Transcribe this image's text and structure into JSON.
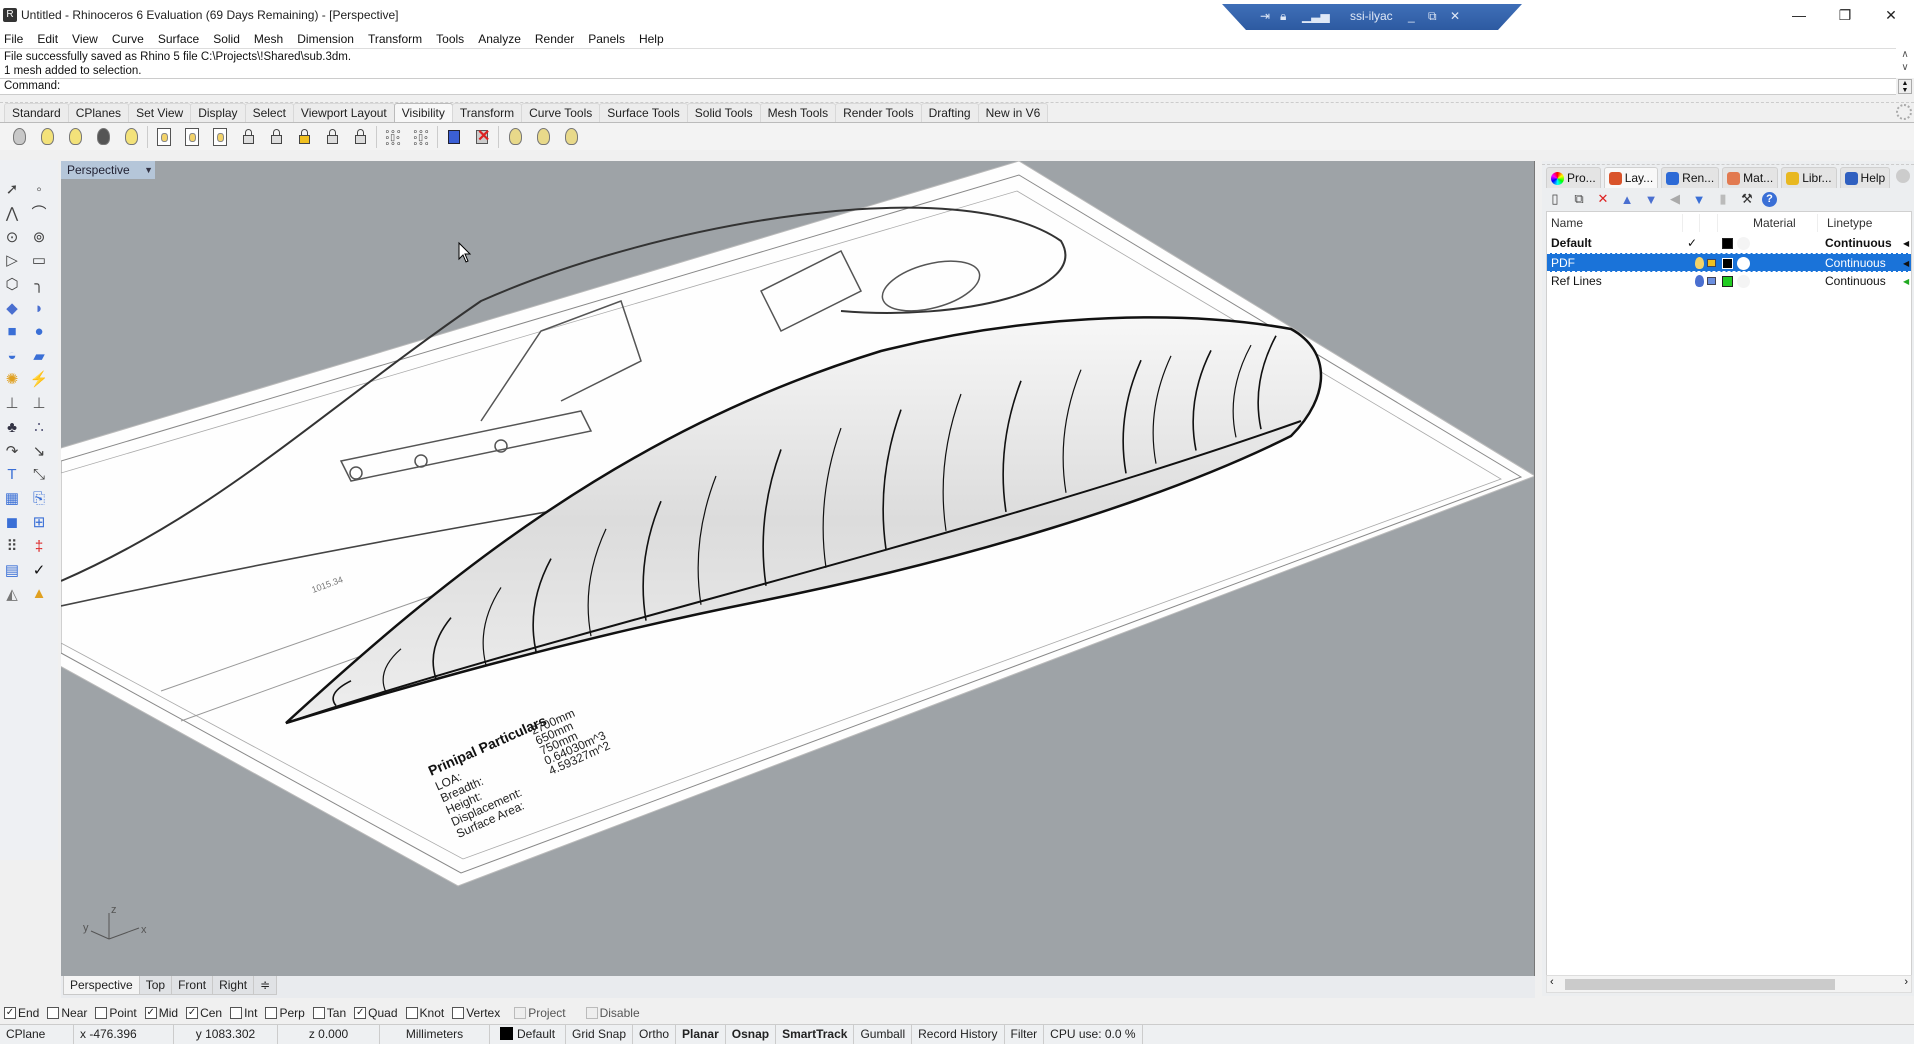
{
  "window": {
    "title": "Untitled - Rhinoceros 6 Evaluation (69 Days Remaining) - [Perspective]",
    "remote_session": "ssi-ilyac",
    "controls": {
      "minimize": "—",
      "restore": "❐",
      "close": "✕"
    }
  },
  "menu": [
    "File",
    "Edit",
    "View",
    "Curve",
    "Surface",
    "Solid",
    "Mesh",
    "Dimension",
    "Transform",
    "Tools",
    "Analyze",
    "Render",
    "Panels",
    "Help"
  ],
  "command_history": [
    "File successfully saved as Rhino 5 file C:\\Projects\\!Shared\\sub.3dm.",
    "1 mesh added to selection."
  ],
  "command": {
    "label": "Command:",
    "value": ""
  },
  "toolbar_tabs": {
    "items": [
      "Standard",
      "CPlanes",
      "Set View",
      "Display",
      "Select",
      "Viewport Layout",
      "Visibility",
      "Transform",
      "Curve Tools",
      "Surface Tools",
      "Solid Tools",
      "Mesh Tools",
      "Render Tools",
      "Drafting",
      "New in V6"
    ],
    "active": "Visibility"
  },
  "visibility_icons": [
    "hide-objects-icon",
    "show-objects-icon",
    "show-selected-icon",
    "hide-swap-icon",
    "swap-hidden-icon",
    "hide-in-detail-icon",
    "show-in-detail-icon",
    "show-selected-in-detail-icon",
    "lock-icon",
    "unlock-icon",
    "unlock-selected-icon",
    "lock-swap-icon",
    "swap-locked-icon",
    "hide-points-icon",
    "show-points-icon",
    "hide-in-viewport-icon",
    "show-in-viewport-icon",
    "hide-layers-icon",
    "show-layers-icon",
    "show-all-layers-icon"
  ],
  "viewport": {
    "name": "Perspective",
    "axes": {
      "x": "x",
      "y": "y",
      "z": "z"
    },
    "drawing": {
      "dimension": "1015.34",
      "particulars_title": "Prinipal Particulars",
      "particulars": [
        {
          "label": "LOA:",
          "value": "2700mm"
        },
        {
          "label": "Breadth:",
          "value": "650mm"
        },
        {
          "label": "Height:",
          "value": "750mm"
        },
        {
          "label": "Displacement:",
          "value": "0.64030m^3"
        },
        {
          "label": "Surface Area:",
          "value": "4.59327m^2"
        }
      ]
    }
  },
  "viewport_tabs": {
    "items": [
      "Perspective",
      "Top",
      "Front",
      "Right"
    ],
    "active": "Perspective",
    "more": "≑"
  },
  "osnaps": [
    {
      "label": "End",
      "checked": true
    },
    {
      "label": "Near",
      "checked": false
    },
    {
      "label": "Point",
      "checked": false
    },
    {
      "label": "Mid",
      "checked": true
    },
    {
      "label": "Cen",
      "checked": true
    },
    {
      "label": "Int",
      "checked": false
    },
    {
      "label": "Perp",
      "checked": false
    },
    {
      "label": "Tan",
      "checked": false
    },
    {
      "label": "Quad",
      "checked": true
    },
    {
      "label": "Knot",
      "checked": false
    },
    {
      "label": "Vertex",
      "checked": false
    },
    {
      "label": "Project",
      "checked": false,
      "disabled": true
    },
    {
      "label": "Disable",
      "checked": false,
      "disabled": true
    }
  ],
  "status": {
    "cplane": "CPlane",
    "x": "x -476.396",
    "y": "y 1083.302",
    "z": "z 0.000",
    "units": "Millimeters",
    "layer": "Default",
    "layer_color": "#000000",
    "toggles": [
      {
        "label": "Grid Snap",
        "on": false
      },
      {
        "label": "Ortho",
        "on": false
      },
      {
        "label": "Planar",
        "on": true
      },
      {
        "label": "Osnap",
        "on": true
      },
      {
        "label": "SmartTrack",
        "on": true
      },
      {
        "label": "Gumball",
        "on": false
      },
      {
        "label": "Record History",
        "on": false
      },
      {
        "label": "Filter",
        "on": false
      }
    ],
    "cpu": "CPU use: 0.0 %"
  },
  "panel": {
    "tabs": [
      {
        "label": "Pro...",
        "icon": "properties-icon"
      },
      {
        "label": "Lay...",
        "icon": "layers-icon"
      },
      {
        "label": "Ren...",
        "icon": "rendering-icon"
      },
      {
        "label": "Mat...",
        "icon": "materials-icon"
      },
      {
        "label": "Libr...",
        "icon": "libraries-icon"
      },
      {
        "label": "Help",
        "icon": "help-icon"
      }
    ],
    "active_tab": "Lay...",
    "tools": [
      "new-layer-icon",
      "new-sublayer-icon",
      "delete-icon",
      "move-up-icon",
      "move-down-icon",
      "move-out-icon",
      "filter-icon",
      "clipboard-icon",
      "tools-icon",
      "help-icon"
    ],
    "columns": [
      "Name",
      "",
      "",
      "",
      "",
      "Material",
      "Linetype"
    ],
    "layers": [
      {
        "name": "Default",
        "current": true,
        "visible": null,
        "locked": null,
        "color": "#000000",
        "linetype": "Continuous",
        "bold": true,
        "selected": false
      },
      {
        "name": "PDF",
        "current": false,
        "visible": true,
        "locked": false,
        "color": "#000000",
        "linetype": "Continuous",
        "bold": false,
        "selected": true
      },
      {
        "name": "Ref Lines",
        "current": false,
        "visible": true,
        "locked": true,
        "color": "#22cc22",
        "linetype": "Continuous",
        "bold": false,
        "selected": false
      }
    ],
    "check_mark": "✓"
  },
  "colors": {
    "accent": "#1a73d9",
    "viewport_bg": "#9ea3a7",
    "remote_bar": "#3a69b2"
  }
}
